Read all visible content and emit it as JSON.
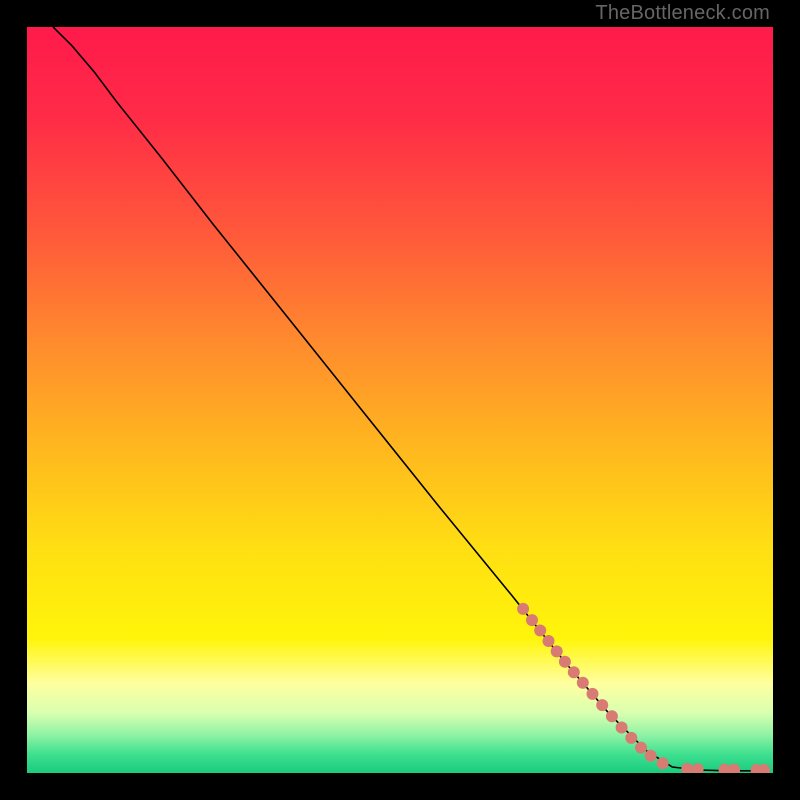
{
  "watermark": "TheBottleneck.com",
  "gradient_stops": [
    {
      "offset": 0.0,
      "color": "#ff1a4b"
    },
    {
      "offset": 0.12,
      "color": "#ff2b47"
    },
    {
      "offset": 0.28,
      "color": "#ff5a3a"
    },
    {
      "offset": 0.42,
      "color": "#ff8a2e"
    },
    {
      "offset": 0.56,
      "color": "#ffb61f"
    },
    {
      "offset": 0.7,
      "color": "#ffdf12"
    },
    {
      "offset": 0.82,
      "color": "#fff50a"
    },
    {
      "offset": 0.88,
      "color": "#ffffa0"
    },
    {
      "offset": 0.92,
      "color": "#d8ffb0"
    },
    {
      "offset": 0.95,
      "color": "#8cf2a4"
    },
    {
      "offset": 0.975,
      "color": "#3ee08f"
    },
    {
      "offset": 1.0,
      "color": "#1acb7e"
    }
  ],
  "chart_data": {
    "type": "line",
    "title": "",
    "xlabel": "",
    "ylabel": "",
    "xlim": [
      0,
      100
    ],
    "ylim": [
      0,
      100
    ],
    "series": [
      {
        "name": "curve",
        "color": "#000000",
        "stroke_width": 1.6,
        "points": [
          {
            "x": 3.5,
            "y": 100.0
          },
          {
            "x": 6.0,
            "y": 97.5
          },
          {
            "x": 9.0,
            "y": 94.0
          },
          {
            "x": 12.0,
            "y": 90.0
          },
          {
            "x": 18.0,
            "y": 82.5
          },
          {
            "x": 25.0,
            "y": 73.5
          },
          {
            "x": 35.0,
            "y": 61.0
          },
          {
            "x": 45.0,
            "y": 48.5
          },
          {
            "x": 55.0,
            "y": 36.0
          },
          {
            "x": 65.0,
            "y": 23.8
          },
          {
            "x": 72.0,
            "y": 15.0
          },
          {
            "x": 78.0,
            "y": 8.0
          },
          {
            "x": 83.0,
            "y": 3.0
          },
          {
            "x": 86.5,
            "y": 0.8
          },
          {
            "x": 90.0,
            "y": 0.4
          },
          {
            "x": 94.0,
            "y": 0.3
          },
          {
            "x": 98.0,
            "y": 0.3
          }
        ]
      },
      {
        "name": "markers-cluster",
        "color": "#d77b73",
        "type": "scatter",
        "radius": 6,
        "points": [
          {
            "x": 66.5,
            "y": 22.0
          },
          {
            "x": 67.7,
            "y": 20.5
          },
          {
            "x": 68.8,
            "y": 19.1
          },
          {
            "x": 69.9,
            "y": 17.7
          },
          {
            "x": 71.0,
            "y": 16.3
          },
          {
            "x": 72.1,
            "y": 14.9
          },
          {
            "x": 73.3,
            "y": 13.5
          },
          {
            "x": 74.5,
            "y": 12.1
          },
          {
            "x": 75.8,
            "y": 10.6
          },
          {
            "x": 77.1,
            "y": 9.1
          },
          {
            "x": 78.4,
            "y": 7.6
          },
          {
            "x": 79.7,
            "y": 6.1
          },
          {
            "x": 81.0,
            "y": 4.7
          },
          {
            "x": 82.3,
            "y": 3.4
          },
          {
            "x": 83.6,
            "y": 2.3
          },
          {
            "x": 85.2,
            "y": 1.3
          },
          {
            "x": 88.5,
            "y": 0.55
          },
          {
            "x": 89.9,
            "y": 0.5
          },
          {
            "x": 93.5,
            "y": 0.45
          },
          {
            "x": 94.8,
            "y": 0.45
          },
          {
            "x": 97.8,
            "y": 0.4
          },
          {
            "x": 98.8,
            "y": 0.4
          }
        ]
      }
    ]
  }
}
